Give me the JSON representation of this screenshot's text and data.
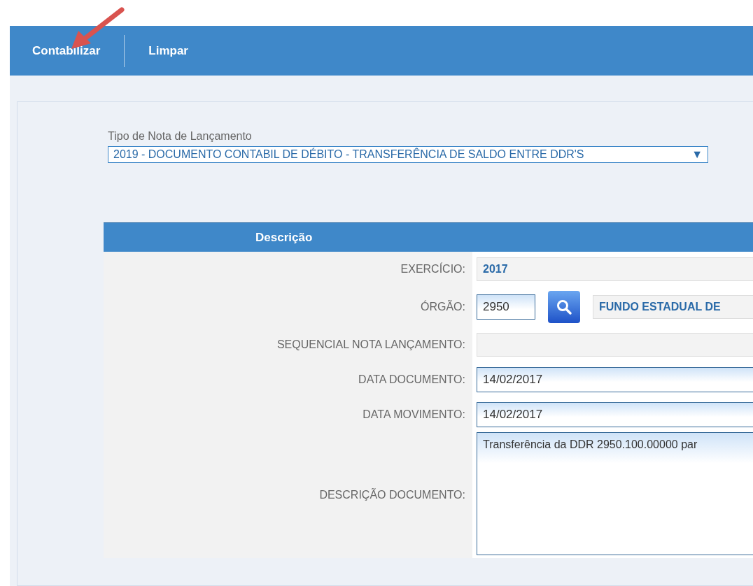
{
  "toolbar": {
    "buttons": [
      {
        "label": "Contabilizar"
      },
      {
        "label": "Limpar"
      }
    ]
  },
  "annotation": {
    "kind": "arrow"
  },
  "note_type": {
    "label": "Tipo de Nota de Lançamento",
    "value": "2019 - DOCUMENTO CONTABIL DE DÉBITO - TRANSFERÊNCIA DE SALDO ENTRE DDR'S",
    "caret": "▼"
  },
  "table": {
    "header": "Descrição",
    "rows": [
      {
        "kind": "readonly",
        "label": "EXERCÍCIO:",
        "value": "2017"
      },
      {
        "kind": "lookup",
        "label": "ÓRGÃO:",
        "value": "2950",
        "name": "FUNDO ESTADUAL DE"
      },
      {
        "kind": "readonly",
        "label": "SEQUENCIAL NOTA LANÇAMENTO:"
      },
      {
        "kind": "input",
        "label": "DATA DOCUMENTO:",
        "value": "14/02/2017"
      },
      {
        "kind": "input",
        "label": "DATA MOVIMENTO:",
        "value": "14/02/2017"
      },
      {
        "kind": "textarea",
        "label": "DESCRIÇÃO DOCUMENTO:",
        "value": "Transferência da DDR 2950.100.00000 par"
      }
    ]
  }
}
